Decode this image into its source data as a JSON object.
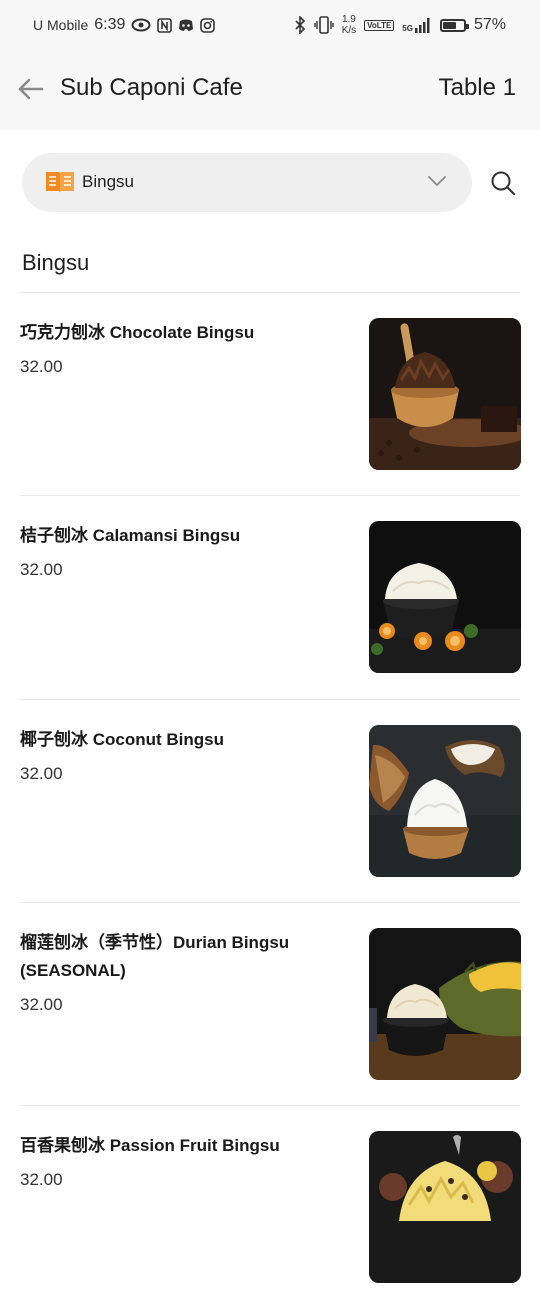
{
  "status_bar": {
    "carrier": "U Mobile",
    "time": "6:39",
    "speed_top": "1.9",
    "speed_bottom": "K/s",
    "volte": "VoLTE",
    "network": "5G",
    "battery_level": 0.57,
    "battery": "57%"
  },
  "header": {
    "back_icon": "arrow-left-icon",
    "title": "Sub Caponi Cafe",
    "table": "Table 1"
  },
  "category_selector": {
    "icon": "menu-book-icon",
    "selected": "Bingsu",
    "dropdown_icon": "chevron-down-icon",
    "search_icon": "search-icon",
    "accent_color": "#f08a24"
  },
  "section": {
    "title": "Bingsu"
  },
  "items": [
    {
      "name": "巧克力刨冰 Chocolate Bingsu",
      "price": "32.00"
    },
    {
      "name": "桔子刨冰 Calamansi Bingsu",
      "price": "32.00"
    },
    {
      "name": "椰子刨冰 Coconut Bingsu",
      "price": "32.00"
    },
    {
      "name": "榴莲刨冰（季节性）Durian Bingsu (SEASONAL)",
      "price": "32.00"
    },
    {
      "name": "百香果刨冰 Passion Fruit Bingsu",
      "price": "32.00"
    }
  ]
}
